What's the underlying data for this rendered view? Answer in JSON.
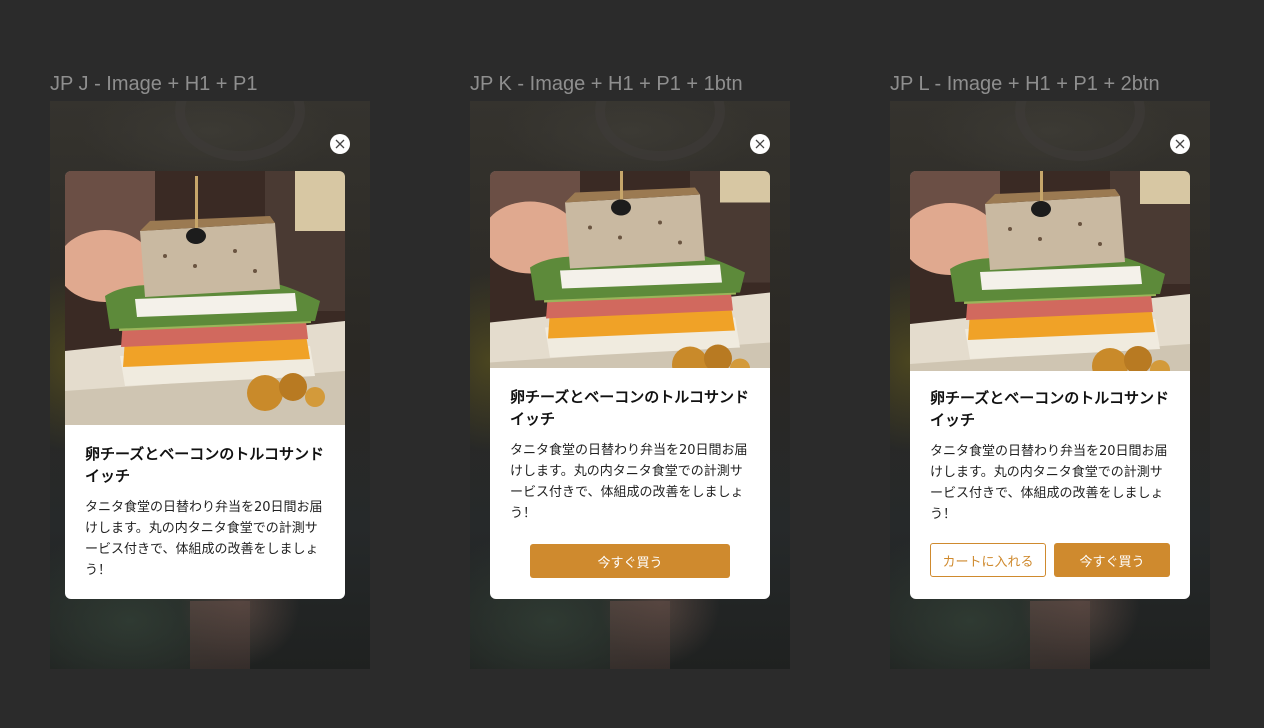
{
  "frames": [
    {
      "label": "JP J - Image + H1 + P1",
      "title": "卵チーズとベーコンのトルコサンドイッチ",
      "body": "タニタ食堂の日替わり弁当を20日間お届けします。丸の内タニタ食堂での計測サービス付きで、体組成の改善をしましょう！",
      "close_icon": "close-icon"
    },
    {
      "label": "JP K - Image + H1 + P1 + 1btn",
      "title": "卵チーズとベーコンのトルコサンドイッチ",
      "body": "タニタ食堂の日替わり弁当を20日間お届けします。丸の内タニタ食堂での計測サービス付きで、体組成の改善をしましょう！",
      "buy_button": "今すぐ買う",
      "close_icon": "close-icon"
    },
    {
      "label": "JP L - Image + H1 + P1 + 2btn",
      "title": "卵チーズとベーコンのトルコサンドイッチ",
      "body": "タニタ食堂の日替わり弁当を20日間お届けします。丸の内タニタ食堂での計測サービス付きで、体組成の改善をしましょう！",
      "cart_button": "カートに入れる",
      "buy_button": "今すぐ買う",
      "close_icon": "close-icon"
    }
  ],
  "colors": {
    "background": "#2b2b2b",
    "accent": "#cf8a2e",
    "card": "#ffffff"
  }
}
